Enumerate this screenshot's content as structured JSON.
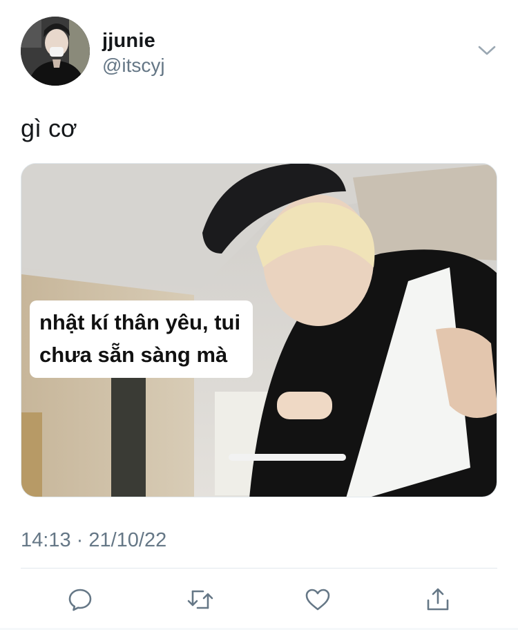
{
  "user": {
    "display_name": "jjunie",
    "handle": "@itscyj",
    "avatar_icon": "profile-photo"
  },
  "tweet": {
    "text": "gì cơ",
    "media": {
      "caption_line_1": "nhật kí thân yêu, tui",
      "caption_line_2": "chưa sẵn sàng mà"
    },
    "timestamp": "14:13 · 21/10/22"
  },
  "actions": [
    {
      "name": "reply",
      "icon": "comment-icon"
    },
    {
      "name": "retweet",
      "icon": "retweet-icon"
    },
    {
      "name": "like",
      "icon": "heart-icon"
    },
    {
      "name": "share",
      "icon": "share-icon"
    }
  ],
  "colors": {
    "text_primary": "#14171a",
    "text_secondary": "#657786",
    "icon": "#657786",
    "divider": "#e1e8ed"
  }
}
